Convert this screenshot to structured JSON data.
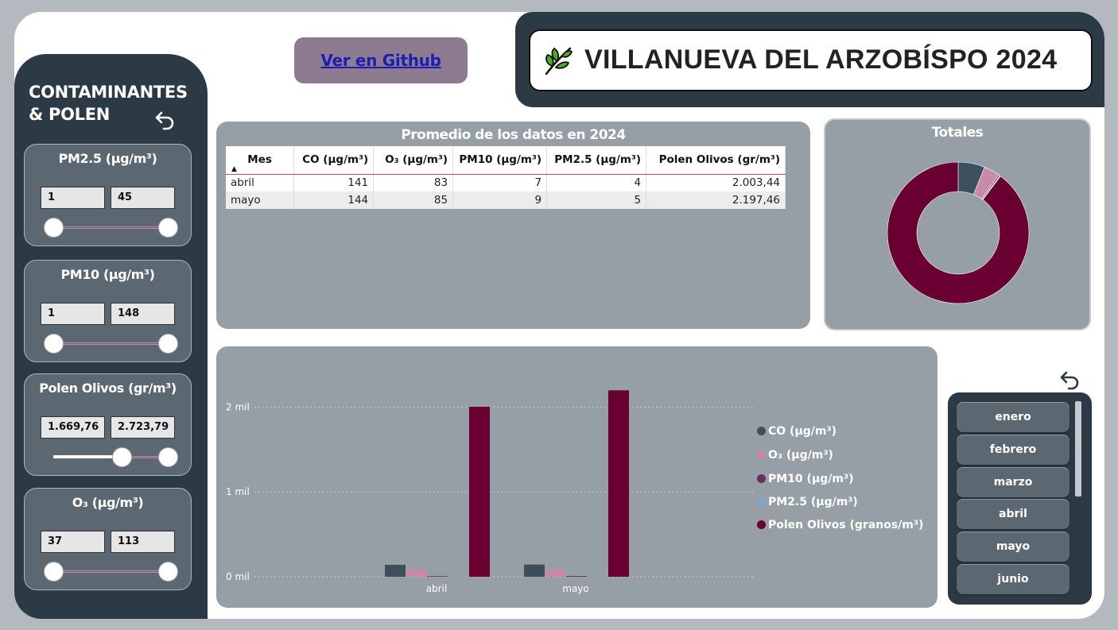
{
  "github": {
    "label": "Ver en Github"
  },
  "header": {
    "title": "VILLANUEVA DEL ARZOBÍSPO 2024",
    "icon": "olive-leaf-icon"
  },
  "sidebar": {
    "title_line1": "CONTAMINANTES",
    "title_line2": "& POLEN",
    "filters": [
      {
        "label": "PM2.5 (µg/m³)",
        "min": "1",
        "max": "45",
        "range_fraction": [
          0,
          1
        ]
      },
      {
        "label": "PM10 (µg/m³)",
        "min": "1",
        "max": "148",
        "range_fraction": [
          0,
          1
        ]
      },
      {
        "label": "Polen Olivos (gr/m³)",
        "min": "1.669,76",
        "max": "2.723,79",
        "range_fraction": [
          0.6,
          1
        ]
      },
      {
        "label": "O₃ (µg/m³)",
        "min": "37",
        "max": "113",
        "range_fraction": [
          0,
          1
        ]
      }
    ]
  },
  "table": {
    "title": "Promedio de los datos en 2024",
    "columns": [
      "Mes",
      "CO (µg/m³)",
      "O₃ (µg/m³)",
      "PM10 (µg/m³)",
      "PM2.5 (µg/m³)",
      "Polen Olivos (gr/m³)"
    ],
    "rows": [
      [
        "abril",
        "141",
        "83",
        "7",
        "4",
        "2.003,44"
      ],
      [
        "mayo",
        "144",
        "85",
        "9",
        "5",
        "2.197,46"
      ]
    ]
  },
  "totals": {
    "title": "Totales",
    "chart_data": {
      "type": "pie",
      "categories": [
        "CO (µg/m³)",
        "O₃ (µg/m³)",
        "PM10 (µg/m³)",
        "PM2.5 (µg/m³)",
        "Polen Olivos (granos/m³)"
      ],
      "values": [
        285,
        168,
        16,
        9,
        4200.9
      ],
      "colors": [
        "#3d4f5c",
        "#c98aa9",
        "#6b2e5a",
        "#7fa6c4",
        "#6a0031"
      ]
    }
  },
  "bar_chart": {
    "chart_data": {
      "type": "bar",
      "categories": [
        "abril",
        "mayo"
      ],
      "series": [
        {
          "name": "CO (µg/m³)",
          "values": [
            141,
            144
          ],
          "color": "#3d4f5c"
        },
        {
          "name": "O₃ (µg/m³)",
          "values": [
            83,
            85
          ],
          "color": "#c98aa9"
        },
        {
          "name": "PM10 (µg/m³)",
          "values": [
            7,
            9
          ],
          "color": "#6b2e5a"
        },
        {
          "name": "PM2.5 (µg/m³)",
          "values": [
            4,
            5
          ],
          "color": "#7fa6c4"
        },
        {
          "name": "Polen Olivos (granos/m³)",
          "values": [
            2003.44,
            2197.46
          ],
          "color": "#6a0031"
        }
      ],
      "yticks": [
        0,
        1000,
        2000
      ],
      "ytick_labels": [
        "0 mil",
        "1 mil",
        "2 mil"
      ],
      "ylim": [
        0,
        2200
      ],
      "legend": "right",
      "grid": true
    }
  },
  "months": [
    "enero",
    "febrero",
    "marzo",
    "abril",
    "mayo",
    "junio"
  ]
}
